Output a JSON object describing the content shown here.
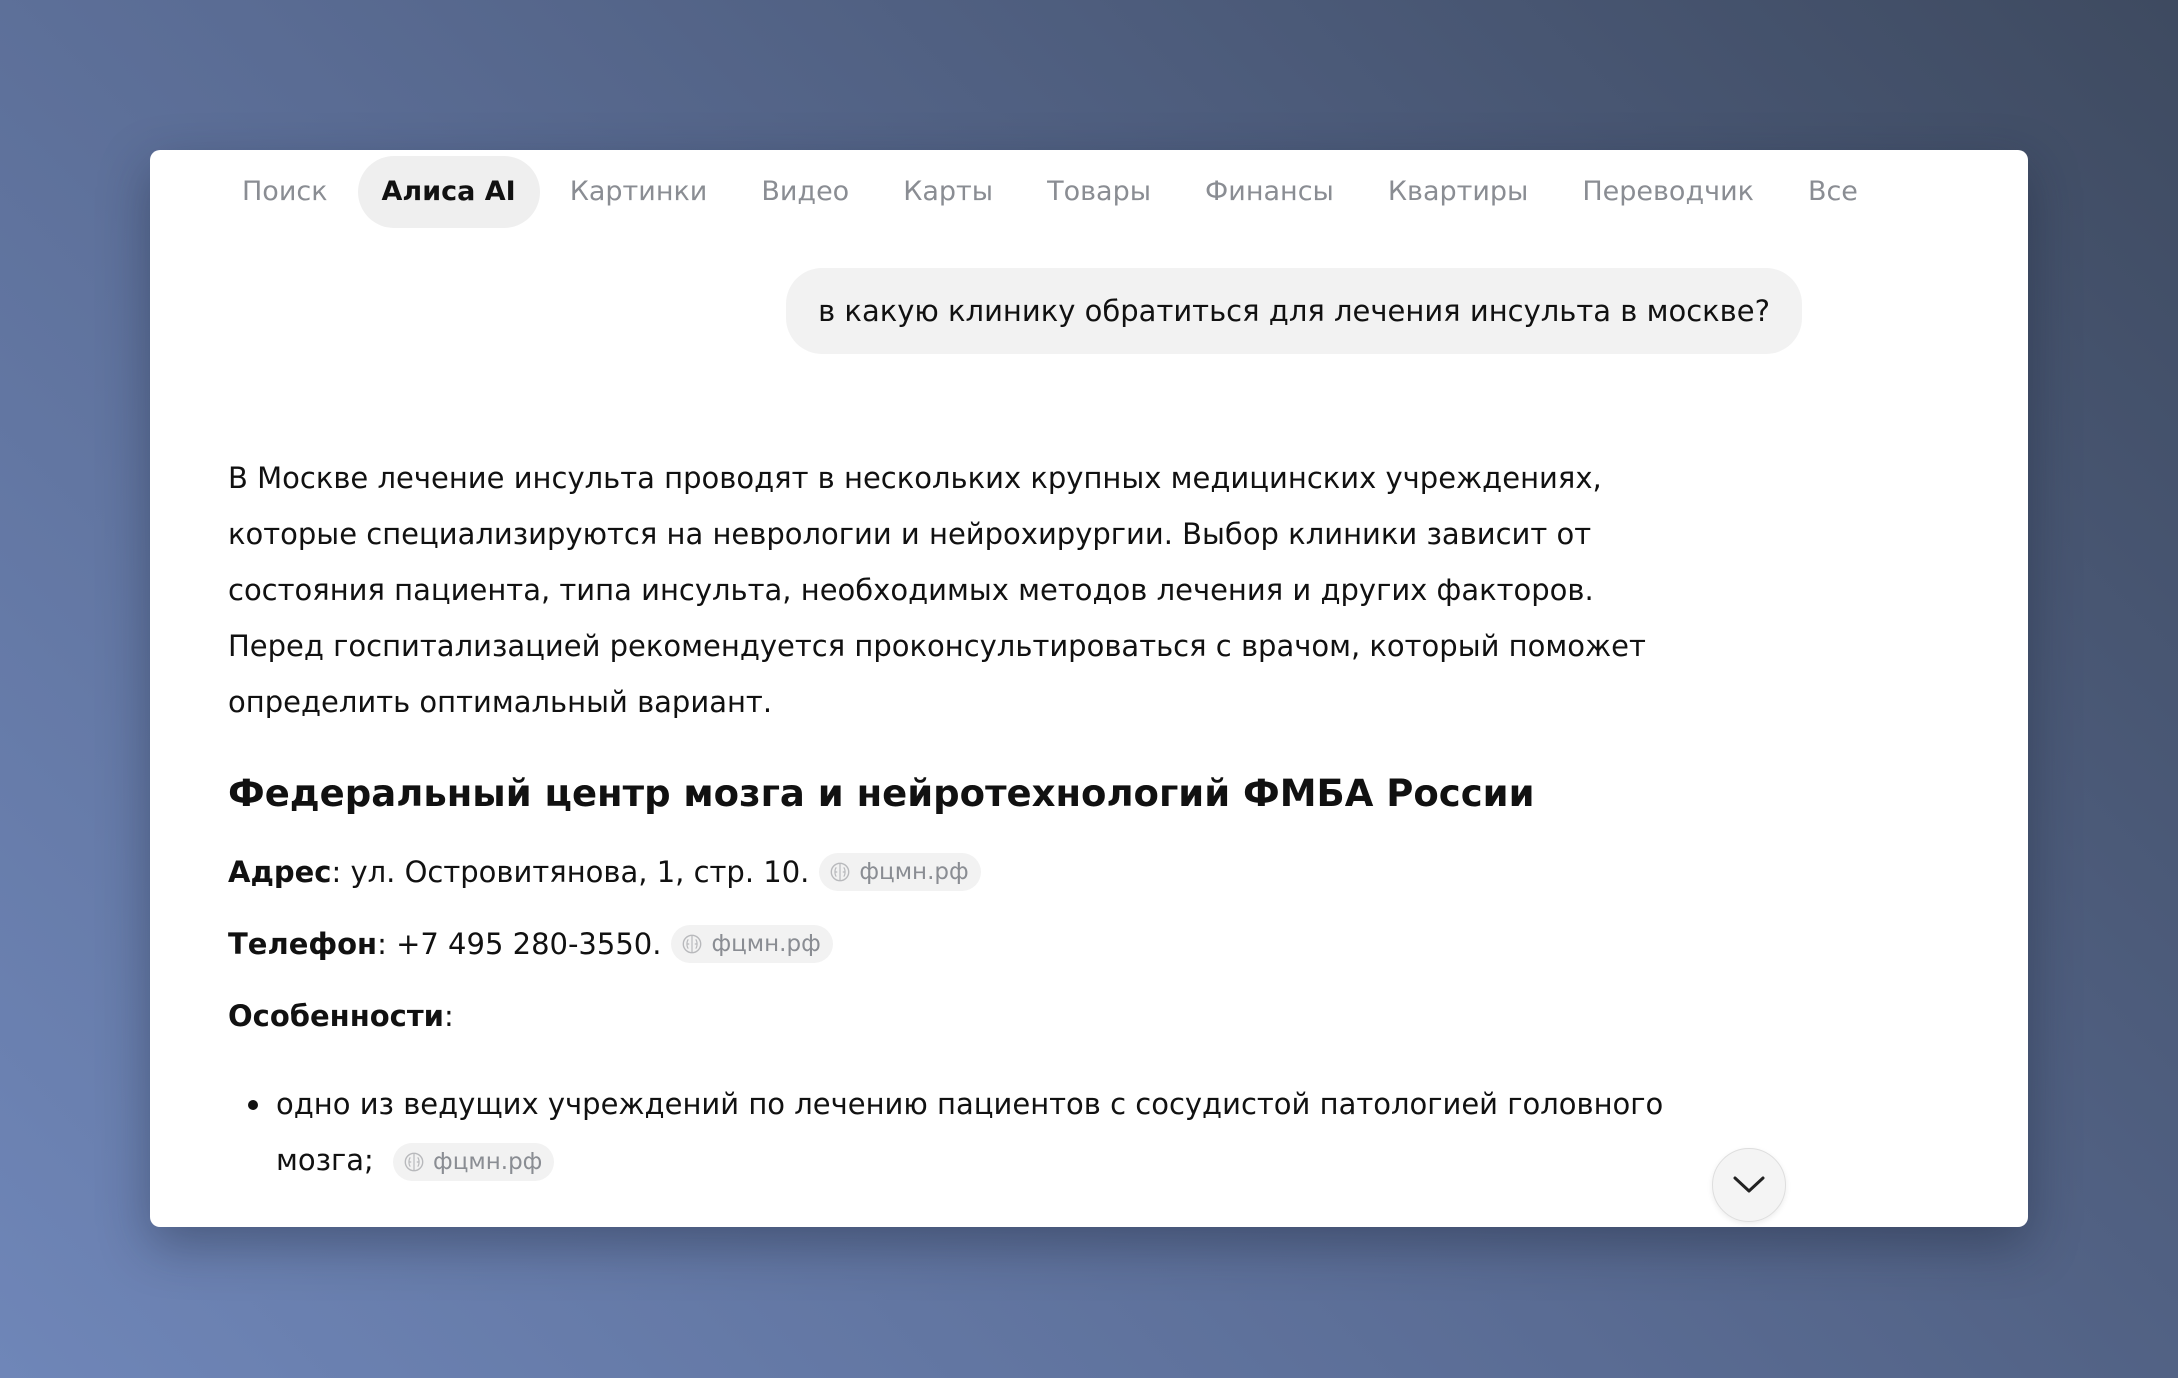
{
  "nav": {
    "tabs": [
      {
        "label": "Поиск",
        "active": false
      },
      {
        "label": "Алиса AI",
        "active": true
      },
      {
        "label": "Картинки",
        "active": false
      },
      {
        "label": "Видео",
        "active": false
      },
      {
        "label": "Карты",
        "active": false
      },
      {
        "label": "Товары",
        "active": false
      },
      {
        "label": "Финансы",
        "active": false
      },
      {
        "label": "Квартиры",
        "active": false
      },
      {
        "label": "Переводчик",
        "active": false
      },
      {
        "label": "Все",
        "active": false
      }
    ]
  },
  "chat": {
    "user_query": "в какую клинику обратиться для лечения инсульта в москве?"
  },
  "answer": {
    "intro": "В Москве лечение инсульта проводят в нескольких крупных медицинских учреждениях, которые специализируются на неврологии и нейрохирургии. Выбор клиники зависит от состояния пациента, типа инсульта, необходимых методов лечения и других факторов. Перед госпитализацией рекомендуется проконсультироваться с врачом, который поможет определить оптимальный вариант.",
    "section_title": "Федеральный центр мозга и нейротехнологий ФМБА России",
    "address_label": "Адрес",
    "address_value": ": ул. Островитянова, 1, стр. 10.",
    "address_source": "фцмн.рф",
    "phone_label": "Телефон",
    "phone_value": ": +7 495 280-3550.",
    "phone_source": "фцмн.рф",
    "features_label": "Особенности",
    "features_colon": ":",
    "bullet_1_text": "одно из ведущих учреждений по лечению пациентов с сосудистой патологией головного мозга;",
    "bullet_1_source": "фцмн.рф"
  },
  "colors": {
    "accent_text": "#111111",
    "muted_text": "#8a8d93",
    "chip_bg": "#f2f2f2"
  },
  "icons": {
    "source_chip": "brain-icon",
    "scroll_down": "chevron-down-icon"
  }
}
